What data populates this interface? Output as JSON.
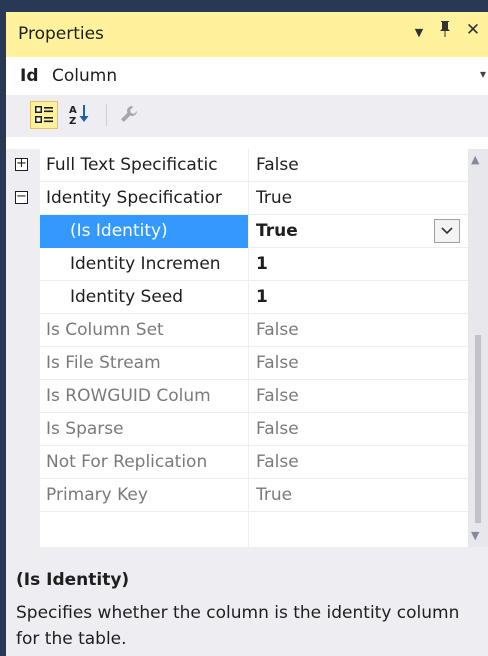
{
  "panel": {
    "title": "Properties",
    "dropdown_glyph": "▼",
    "pin_glyph": "📌",
    "close_glyph": "✕"
  },
  "object": {
    "name": "Id",
    "type": "Column"
  },
  "toolbar": {
    "categorized_icon": "categorized-icon",
    "alphabetical_icon": "alphabetical-icon",
    "property_pages_icon": "wrench-icon"
  },
  "properties": [
    {
      "name": "Full Text Specificatic",
      "value": "False",
      "expander": "+",
      "indent": 0,
      "state": "normal"
    },
    {
      "name": "Identity Specificatior",
      "value": "True",
      "expander": "−",
      "indent": 0,
      "state": "normal"
    },
    {
      "name": "(Is Identity)",
      "value": "True",
      "expander": "",
      "indent": 1,
      "state": "selected"
    },
    {
      "name": "Identity Incremen",
      "value": "1",
      "expander": "",
      "indent": 1,
      "state": "bold"
    },
    {
      "name": "Identity Seed",
      "value": "1",
      "expander": "",
      "indent": 1,
      "state": "bold"
    },
    {
      "name": "Is Column Set",
      "value": "False",
      "expander": "",
      "indent": 0,
      "state": "disabled"
    },
    {
      "name": "Is File Stream",
      "value": "False",
      "expander": "",
      "indent": 0,
      "state": "disabled"
    },
    {
      "name": "Is ROWGUID Colum",
      "value": "False",
      "expander": "",
      "indent": 0,
      "state": "disabled"
    },
    {
      "name": "Is Sparse",
      "value": "False",
      "expander": "",
      "indent": 0,
      "state": "disabled"
    },
    {
      "name": "Not For Replication",
      "value": "False",
      "expander": "",
      "indent": 0,
      "state": "disabled"
    },
    {
      "name": "Primary Key",
      "value": "True",
      "expander": "",
      "indent": 0,
      "state": "disabled"
    }
  ],
  "description": {
    "title": "(Is Identity)",
    "text": "Specifies whether the column is the identity column for the table."
  },
  "colors": {
    "title_bar": "#fff29d",
    "selection": "#3399ff",
    "frame": "#293955",
    "disabled_text": "#7a7a7a"
  }
}
